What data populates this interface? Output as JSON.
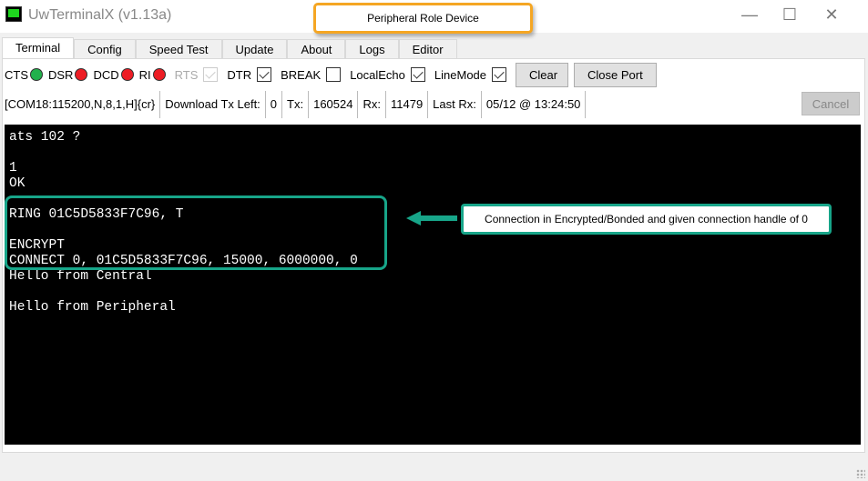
{
  "window": {
    "title": "UwTerminalX (v1.13a)",
    "minimize": "—",
    "maximize": "☐",
    "close": "✕"
  },
  "annotation_top": "Peripheral Role Device",
  "tabs": [
    "Terminal",
    "Config",
    "Speed Test",
    "Update",
    "About",
    "Logs",
    "Editor"
  ],
  "signals": {
    "cts": "CTS",
    "dsr": "DSR",
    "dcd": "DCD",
    "ri": "RI",
    "rts": "RTS",
    "dtr": "DTR",
    "break": "BREAK",
    "localecho": "LocalEcho",
    "linemode": "LineMode",
    "colors": {
      "on": "#22b14c",
      "off": "#ed1c24"
    }
  },
  "buttons": {
    "clear": "Clear",
    "close_port": "Close Port",
    "cancel": "Cancel"
  },
  "status": {
    "port": "[COM18:115200,N,8,1,H]{cr}",
    "download_label": "Download Tx Left:",
    "download_value": "0",
    "tx_label": "Tx:",
    "tx_value": "160524",
    "rx_label": "Rx:",
    "rx_value": "11479",
    "last_rx_label": "Last Rx:",
    "last_rx_value": "05/12 @ 13:24:50"
  },
  "terminal_lines": [
    "ats 102 ?",
    "",
    "1",
    "OK",
    "",
    "RING 01C5D5833F7C96, T",
    "",
    "ENCRYPT",
    "CONNECT 0, 01C5D5833F7C96, 15000, 6000000, 0",
    "Hello from Central",
    "",
    "Hello from Peripheral"
  ],
  "annotation_callout": "Connection in Encrypted/Bonded and given connection handle of 0",
  "accent": "#17a589"
}
